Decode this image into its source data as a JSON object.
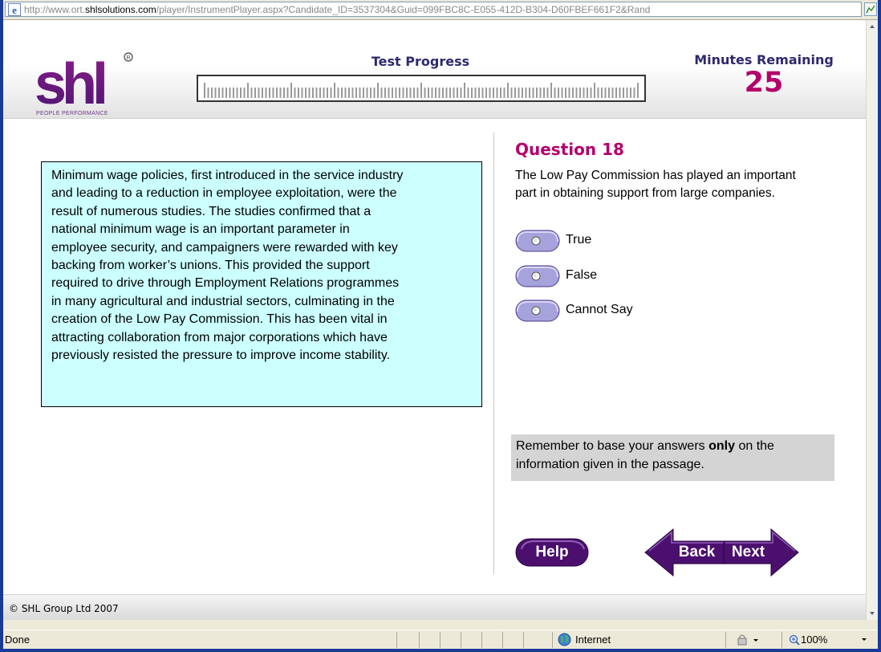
{
  "browser": {
    "url_prefix": "http://www.ort.",
    "url_domain": "shlsolutions.com",
    "url_rest": "/player/InstrumentPlayer.aspx?Candidate_ID=3537304&Guid=099FBC8C-E055-412D-B304-D60FBEF661F2&Rand"
  },
  "header": {
    "logo_text": "shl",
    "logo_tagline": "PEOPLE PERFORMANCE",
    "progress_title": "Test Progress",
    "minutes_title": "Minutes Remaining",
    "minutes_value": "25"
  },
  "passage": {
    "lines": [
      "Minimum wage policies, first introduced in the service industry",
      "and leading to a reduction in employee exploitation, were the",
      "result of numerous studies. The studies confirmed that a",
      "national minimum wage is an important parameter in",
      "employee security, and campaigners were rewarded with key",
      "backing from worker’s unions. This provided the support",
      "required to drive through Employment Relations programmes",
      "in many agricultural and industrial sectors, culminating in the",
      "creation of the Low Pay Commission. This has been vital in",
      "attracting collaboration from major corporations which have",
      "previously resisted the pressure to improve income stability."
    ]
  },
  "question": {
    "title": "Question 18",
    "lines": [
      "The Low Pay Commission has played an important",
      "part in obtaining support from large companies."
    ],
    "options": [
      "True",
      "False",
      "Cannot Say"
    ]
  },
  "reminder": {
    "part1": "Remember to base your answers ",
    "emphasis": "only",
    "part2": " on the",
    "line2": "information given in the passage."
  },
  "nav": {
    "help_label": "Help",
    "back_label": "Back",
    "next_label": "Next"
  },
  "footer": {
    "copyright": "© SHL Group Ltd 2007"
  },
  "statusbar": {
    "status": "Done",
    "zone": "Internet",
    "zoom": "100%"
  },
  "colors": {
    "accent": "#b3006a",
    "heading": "#2c2a6e",
    "button": "#4b0f6e",
    "passage_bg": "#ccffff",
    "radio": "#a6a2dc"
  }
}
